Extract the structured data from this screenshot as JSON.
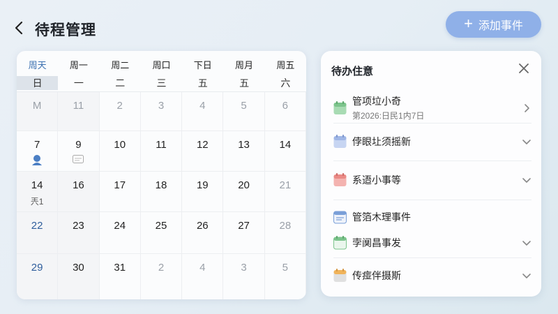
{
  "header": {
    "title": "待程管理",
    "add_label": "添加事件"
  },
  "calendar": {
    "weekday_headers": [
      {
        "top": "周天",
        "bottom": "日"
      },
      {
        "top": "周一",
        "bottom": "一"
      },
      {
        "top": "周二",
        "bottom": "二"
      },
      {
        "top": "周口",
        "bottom": "三"
      },
      {
        "top": "下日",
        "bottom": "五"
      },
      {
        "top": "周月",
        "bottom": "五"
      },
      {
        "top": "周五",
        "bottom": "六"
      }
    ],
    "weeks": [
      [
        "M",
        "11",
        "2",
        "3",
        "4",
        "5",
        "6"
      ],
      [
        "7",
        "9",
        "10",
        "11",
        "12",
        "13",
        "14"
      ],
      [
        "14",
        "16",
        "17",
        "18",
        "19",
        "20",
        "21"
      ],
      [
        "22",
        "23",
        "24",
        "25",
        "26",
        "27",
        "28"
      ],
      [
        "29",
        "30",
        "31",
        "2",
        "4",
        "3",
        "5"
      ]
    ],
    "sub_label_14": "兲1"
  },
  "panel": {
    "title": "待办住意",
    "items": [
      {
        "title": "管项垃小奇",
        "subtitle": "第2026:日民1内7日",
        "icon_color": "#7cc48c",
        "chevron": "right"
      },
      {
        "title": "侼眼圵须摇新",
        "icon_color": "#9fb6e6",
        "chevron": "down"
      },
      {
        "title": "系逜小事等",
        "icon_color": "#ea8a86",
        "chevron": "down"
      },
      {
        "title": "管箔木理事件",
        "icon_color": "#7a9fd8",
        "chevron": ""
      },
      {
        "title": "孛阒昌事发",
        "icon_color": "#7cc48c",
        "chevron": "down"
      },
      {
        "title": "传痖伴摄斯",
        "icon_color": "#f0b35a",
        "chevron": "down"
      }
    ]
  },
  "colors": {
    "accent": "#8fb0e8",
    "today_text": "#2f5e9c",
    "selection": "#d6e3f6"
  }
}
